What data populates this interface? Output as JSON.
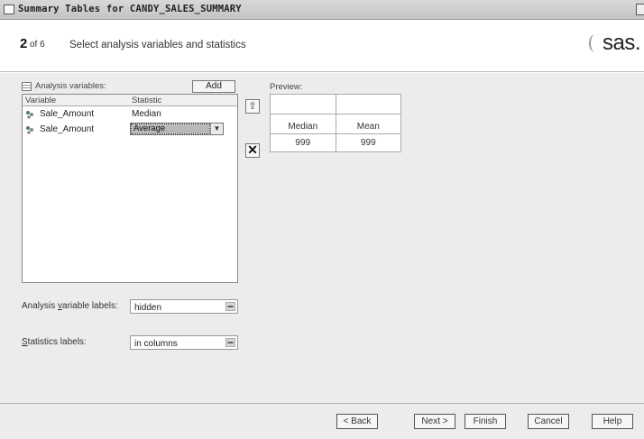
{
  "window": {
    "title": "Summary Tables for CANDY_SALES_SUMMARY"
  },
  "header": {
    "step_number": "2",
    "step_of": "of 6",
    "step_title": "Select analysis variables and statistics",
    "logo": "sas."
  },
  "analysis_variables": {
    "label": "Analysis variables:",
    "add_label": "Add",
    "columns": [
      "Variable",
      "Statistic"
    ],
    "rows": [
      {
        "variable": "Sale_Amount",
        "statistic": "Median"
      },
      {
        "variable": "Sale_Amount",
        "statistic": "Average"
      }
    ]
  },
  "preview": {
    "label": "Preview:",
    "headers": [
      "Median",
      "Mean"
    ],
    "values": [
      "999",
      "999"
    ]
  },
  "options": {
    "var_labels_label": "Analysis variable labels:",
    "var_labels_value": "hidden",
    "stat_labels_label": "Statistics labels:",
    "stat_labels_value": "in columns"
  },
  "footer": {
    "back": "< Back",
    "next": "Next >",
    "finish": "Finish",
    "cancel": "Cancel",
    "help": "Help"
  },
  "icons": {
    "window": "window-icon",
    "close": "close-icon",
    "grid": "grid-icon",
    "variable": "numeric-variable-icon",
    "move_up": "arrow-up-icon",
    "delete": "delete-x-icon",
    "dropdown": "chevron-down-icon"
  }
}
